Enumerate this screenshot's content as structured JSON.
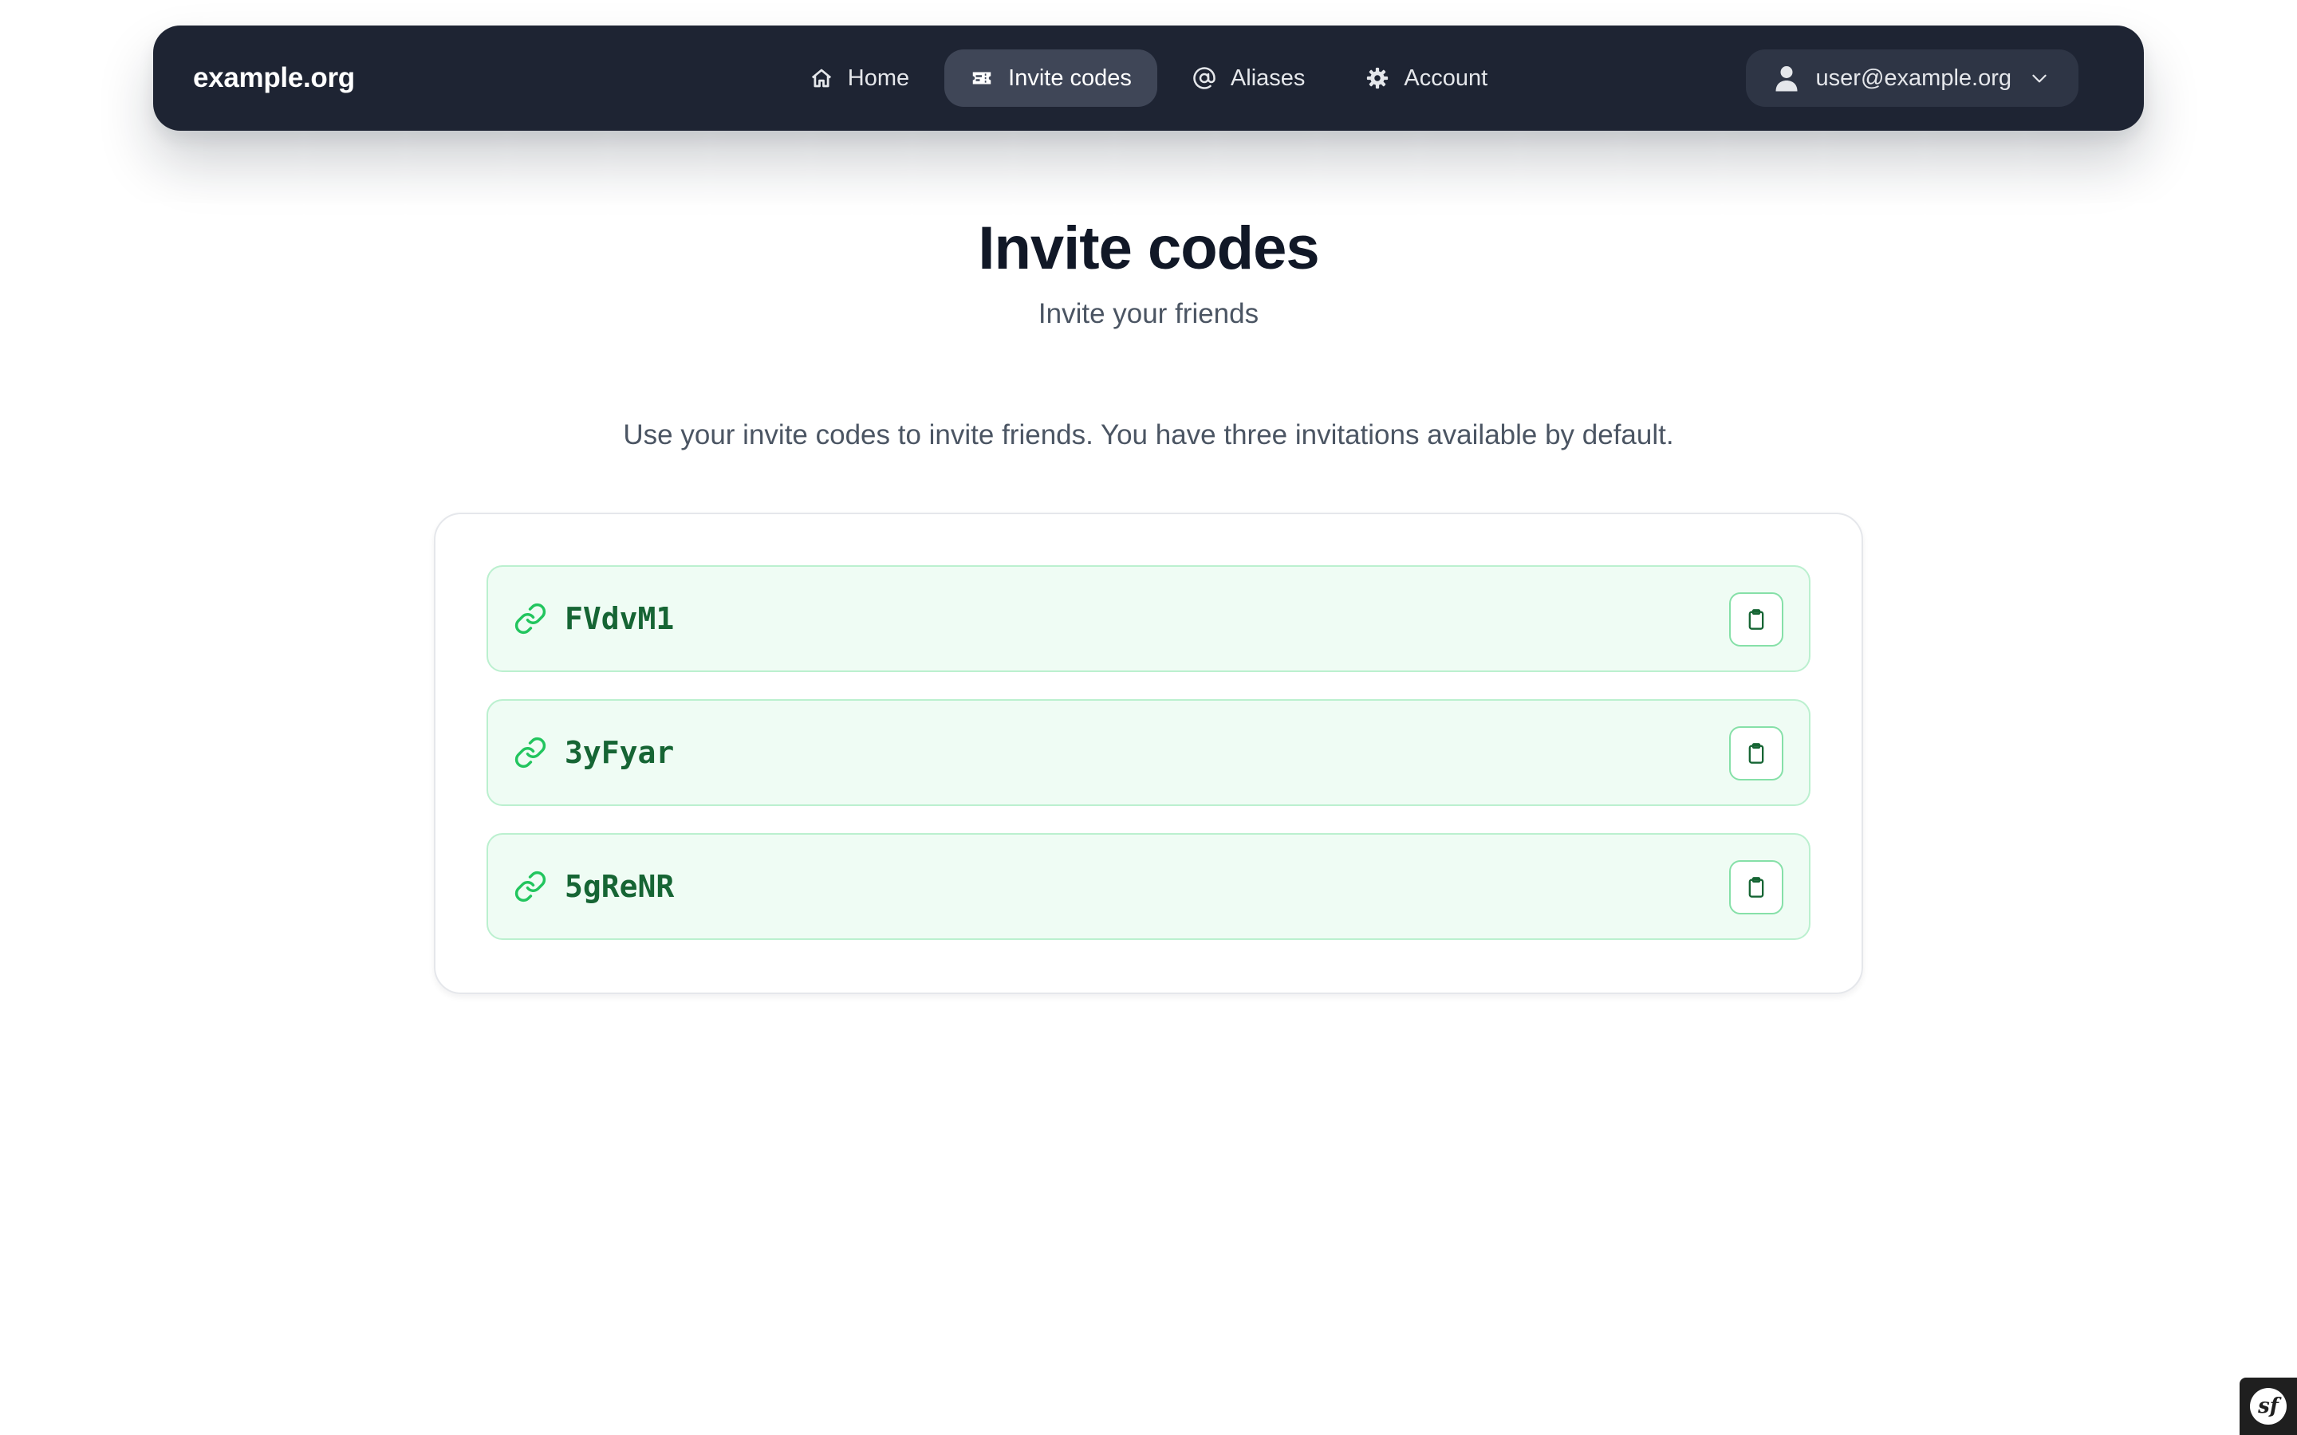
{
  "nav": {
    "brand": "example.org",
    "items": [
      {
        "label": "Home",
        "icon": "home-icon",
        "active": false
      },
      {
        "label": "Invite codes",
        "icon": "ticket-icon",
        "active": true
      },
      {
        "label": "Aliases",
        "icon": "at-sign-icon",
        "active": false
      },
      {
        "label": "Account",
        "icon": "gear-icon",
        "active": false
      }
    ],
    "user": {
      "email": "user@example.org",
      "icon": "user-icon",
      "dropdown_icon": "chevron-down-icon"
    }
  },
  "page": {
    "title": "Invite codes",
    "subtitle": "Invite your friends",
    "description": "Use your invite codes to invite friends. You have three invitations available by default."
  },
  "invite_codes": [
    {
      "code": "FVdvM1",
      "icon": "link-icon",
      "action_icon": "clipboard-icon"
    },
    {
      "code": "3yFyar",
      "icon": "link-icon",
      "action_icon": "clipboard-icon"
    },
    {
      "code": "5gReNR",
      "icon": "link-icon",
      "action_icon": "clipboard-icon"
    }
  ],
  "debug_toolbar": {
    "logo_text": "sf",
    "icon": "symfony-logo-icon"
  },
  "colors": {
    "navbar_bg": "#1e2433",
    "nav_active_bg": "#3f4657",
    "code_row_bg": "#effcf4",
    "code_row_border": "#bbf0cf",
    "code_text": "#166534",
    "accent_green": "#22c55e"
  }
}
